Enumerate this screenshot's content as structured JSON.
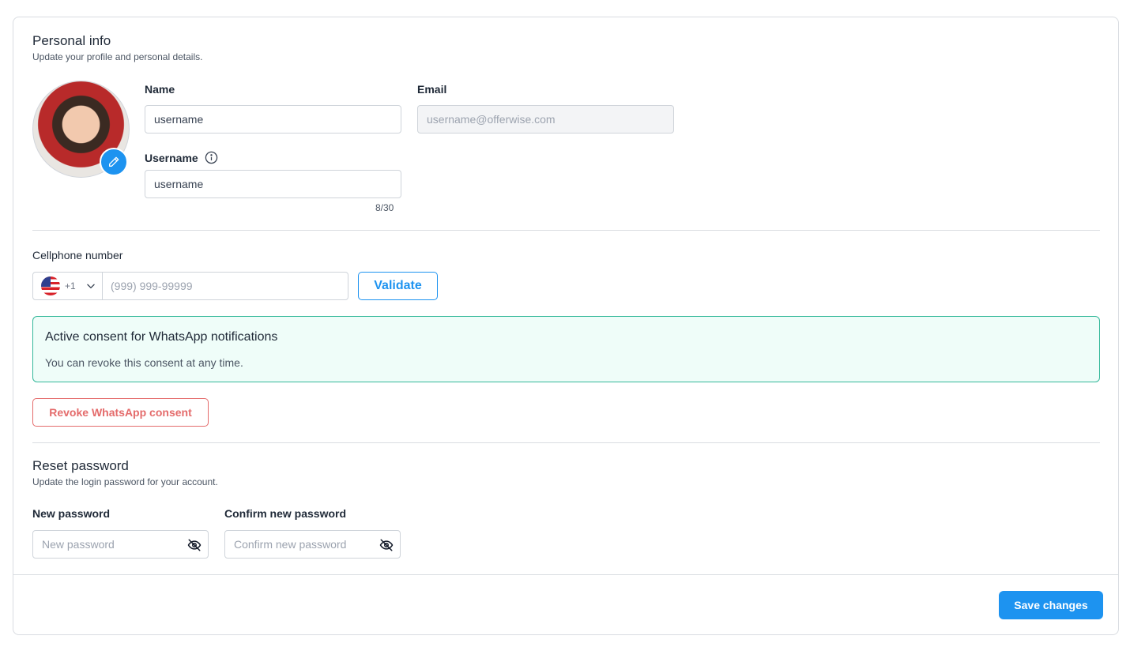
{
  "personal": {
    "title": "Personal info",
    "subtitle": "Update your profile and personal details.",
    "name_label": "Name",
    "name_value": "username",
    "email_label": "Email",
    "email_placeholder": "username@offerwise.com",
    "username_label": "Username",
    "username_value": "username",
    "username_counter": "8/30"
  },
  "phone": {
    "label": "Cellphone number",
    "country_code": "+1",
    "placeholder": "(999) 999-99999",
    "validate_label": "Validate"
  },
  "consent": {
    "title": "Active consent for WhatsApp notifications",
    "text": "You can revoke this consent at any time.",
    "revoke_label": "Revoke WhatsApp consent"
  },
  "password": {
    "title": "Reset password",
    "subtitle": "Update the login password for your account.",
    "new_label": "New password",
    "new_placeholder": "New password",
    "confirm_label": "Confirm new password",
    "confirm_placeholder": "Confirm new password"
  },
  "footer": {
    "save_label": "Save changes"
  },
  "colors": {
    "accent": "#1d93f0",
    "danger": "#e46b6b",
    "success_border": "#34b89a",
    "success_bg": "#effdf9"
  }
}
